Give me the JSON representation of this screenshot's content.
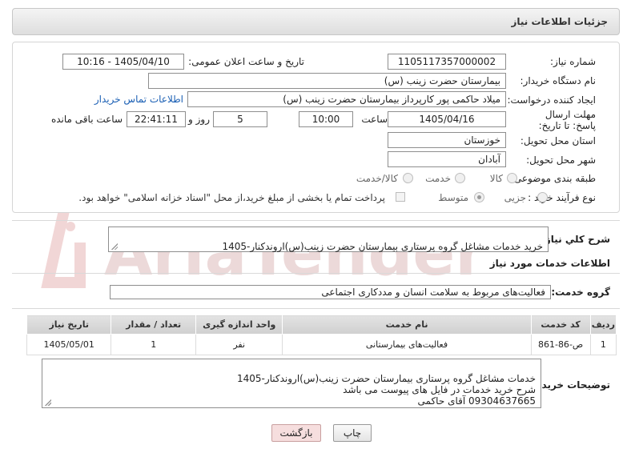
{
  "header": {
    "title": "جزئیات اطلاعات نیاز"
  },
  "form": {
    "need_number_label": "شماره نیاز:",
    "need_number": "1105117357000002",
    "announce_label": "تاریخ و ساعت اعلان عمومی:",
    "announce_value": "1405/04/10 - 10:16",
    "buyer_org_label": "نام دستگاه خریدار:",
    "buyer_org": "بیمارستان حضرت زینب (س)",
    "requester_label": "ایجاد کننده درخواست:",
    "requester": "میلاد حاکمی پور کارپرداز بیمارستان حضرت زینب (س)",
    "contact_link": "اطلاعات تماس خریدار",
    "deadline_label": "مهلت ارسال پاسخ: تا تاریخ:",
    "deadline_date": "1405/04/16",
    "time_label": "ساعت",
    "deadline_time": "10:00",
    "days_value": "5",
    "days_label": "روز و",
    "remaining_time": "22:41:11",
    "remaining_label": "ساعت باقی مانده",
    "province_label": "استان محل تحویل:",
    "province": "خوزستان",
    "city_label": "شهر محل تحویل:",
    "city": "آبادان",
    "category_label": "طبقه بندی موضوعی:",
    "category_options": [
      "کالا",
      "خدمت",
      "کالا/خدمت"
    ],
    "purchase_type_label": "نوع فرآیند خرید :",
    "purchase_options": [
      "جزیی",
      "متوسط"
    ],
    "payment_note": "پرداخت تمام یا بخشی از مبلغ خرید،از محل \"اسناد خزانه اسلامی\" خواهد بود."
  },
  "summary": {
    "label": "شرح كلي نياز:",
    "text": "خرید خدمات مشاغل گروه پرستاری بیمارستان حضرت زینب(س)اروندکنار-1405"
  },
  "services": {
    "section_title": "اطلاعات خدمات مورد نیاز",
    "group_label": "گروه خدمت:",
    "group_value": "فعالیت‌های مربوط به سلامت انسان و مددکاری اجتماعی",
    "columns": [
      "ردیف",
      "کد خدمت",
      "نام خدمت",
      "واحد اندازه گیری",
      "تعداد / مقدار",
      "تاریخ نیاز"
    ],
    "rows": [
      [
        "1",
        "ص-86-861",
        "فعالیت‌های بیمارستانی",
        "نفر",
        "1",
        "1405/05/01"
      ]
    ]
  },
  "buyer_notes": {
    "label": "توضیحات خریدار:",
    "text": "خدمات مشاغل گروه پرستاری بیمارستان حضرت زینب(س)اروندکنار-1405\nشرح خرید خدمات در فایل های پیوست می باشد\n09304637665 آقای حاکمی"
  },
  "buttons": {
    "print": "چاپ",
    "back": "بازگشت"
  },
  "watermark": {
    "text": "AriaTender.net"
  },
  "colors": {
    "link": "#1a5fb4",
    "back_button_bg": "#f6dede",
    "header_bg": "#e6e6e6"
  }
}
